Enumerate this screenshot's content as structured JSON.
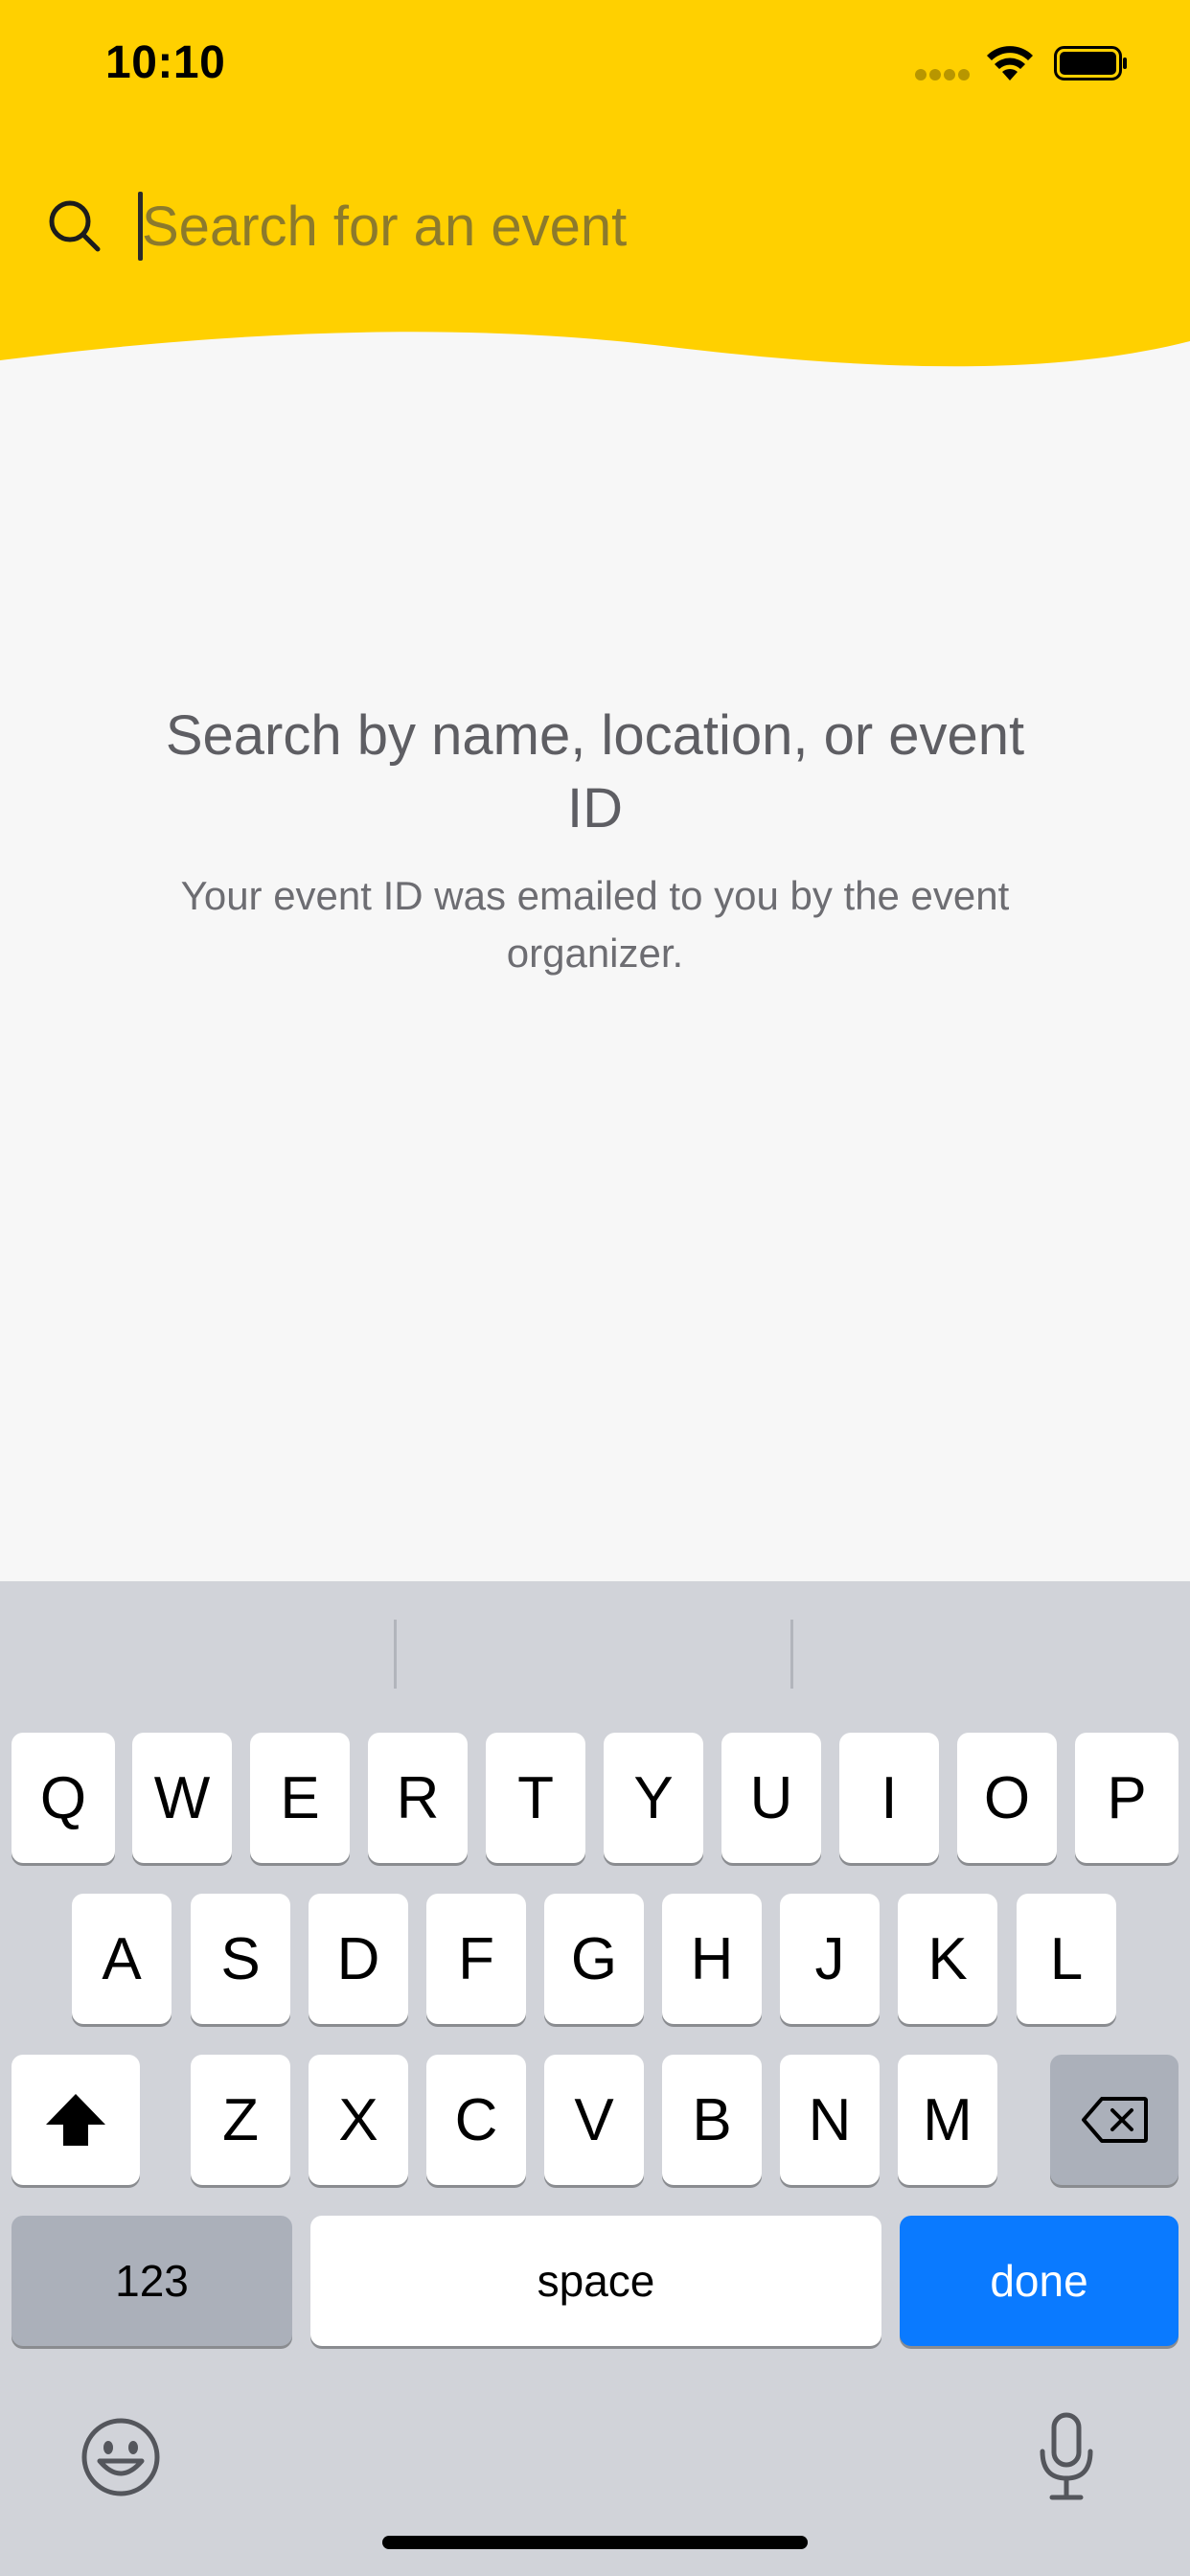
{
  "status_bar": {
    "time": "10:10"
  },
  "search": {
    "placeholder": "Search for an event",
    "value": ""
  },
  "empty_state": {
    "title": "Search by name, location, or event ID",
    "subtitle": "Your event ID was emailed to you by the event organizer."
  },
  "keyboard": {
    "row1": [
      "Q",
      "W",
      "E",
      "R",
      "T",
      "Y",
      "U",
      "I",
      "O",
      "P"
    ],
    "row2": [
      "A",
      "S",
      "D",
      "F",
      "G",
      "H",
      "J",
      "K",
      "L"
    ],
    "row3": [
      "Z",
      "X",
      "C",
      "V",
      "B",
      "N",
      "M"
    ],
    "numbers_label": "123",
    "space_label": "space",
    "done_label": "done"
  },
  "colors": {
    "header": "#ffd000",
    "background": "#f7f7f7",
    "keyboard": "#d1d3d9",
    "done": "#0a7aff"
  },
  "icons": [
    "search-icon",
    "signal-dots-icon",
    "wifi-icon",
    "battery-icon",
    "shift-icon",
    "backspace-icon",
    "emoji-icon",
    "microphone-icon"
  ]
}
